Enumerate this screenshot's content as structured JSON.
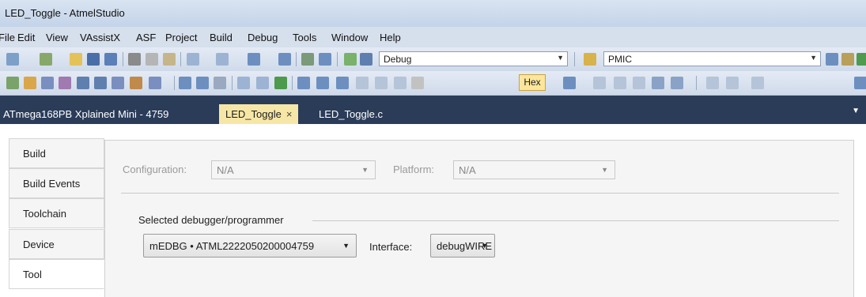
{
  "window": {
    "title": "LED_Toggle - AtmelStudio"
  },
  "menu": [
    "File",
    "Edit",
    "View",
    "VAssistX",
    "ASF",
    "Project",
    "Build",
    "Debug",
    "Tools",
    "Window",
    "Help"
  ],
  "toolbar": {
    "config_value": "Debug",
    "platform_value": "PMIC",
    "hex_label": "Hex"
  },
  "tabs": [
    {
      "label": "ATmega168PB Xplained Mini - 4759"
    },
    {
      "label": "LED_Toggle",
      "close": "×"
    },
    {
      "label": "LED_Toggle.c"
    }
  ],
  "nav": [
    "Build",
    "Build Events",
    "Toolchain",
    "Device",
    "Tool"
  ],
  "panel": {
    "configuration_label": "Configuration:",
    "configuration_value": "N/A",
    "platform_label": "Platform:",
    "platform_value": "N/A",
    "debugger_heading": "Selected debugger/programmer",
    "debugger_value": "mEDBG • ATML2222050200004759",
    "interface_label": "Interface:",
    "interface_value": "debugWIRE"
  },
  "colors": {
    "tabbar": "#2b3c59",
    "active_tab": "#f7e7a6",
    "hex_button": "#fbe69b"
  }
}
